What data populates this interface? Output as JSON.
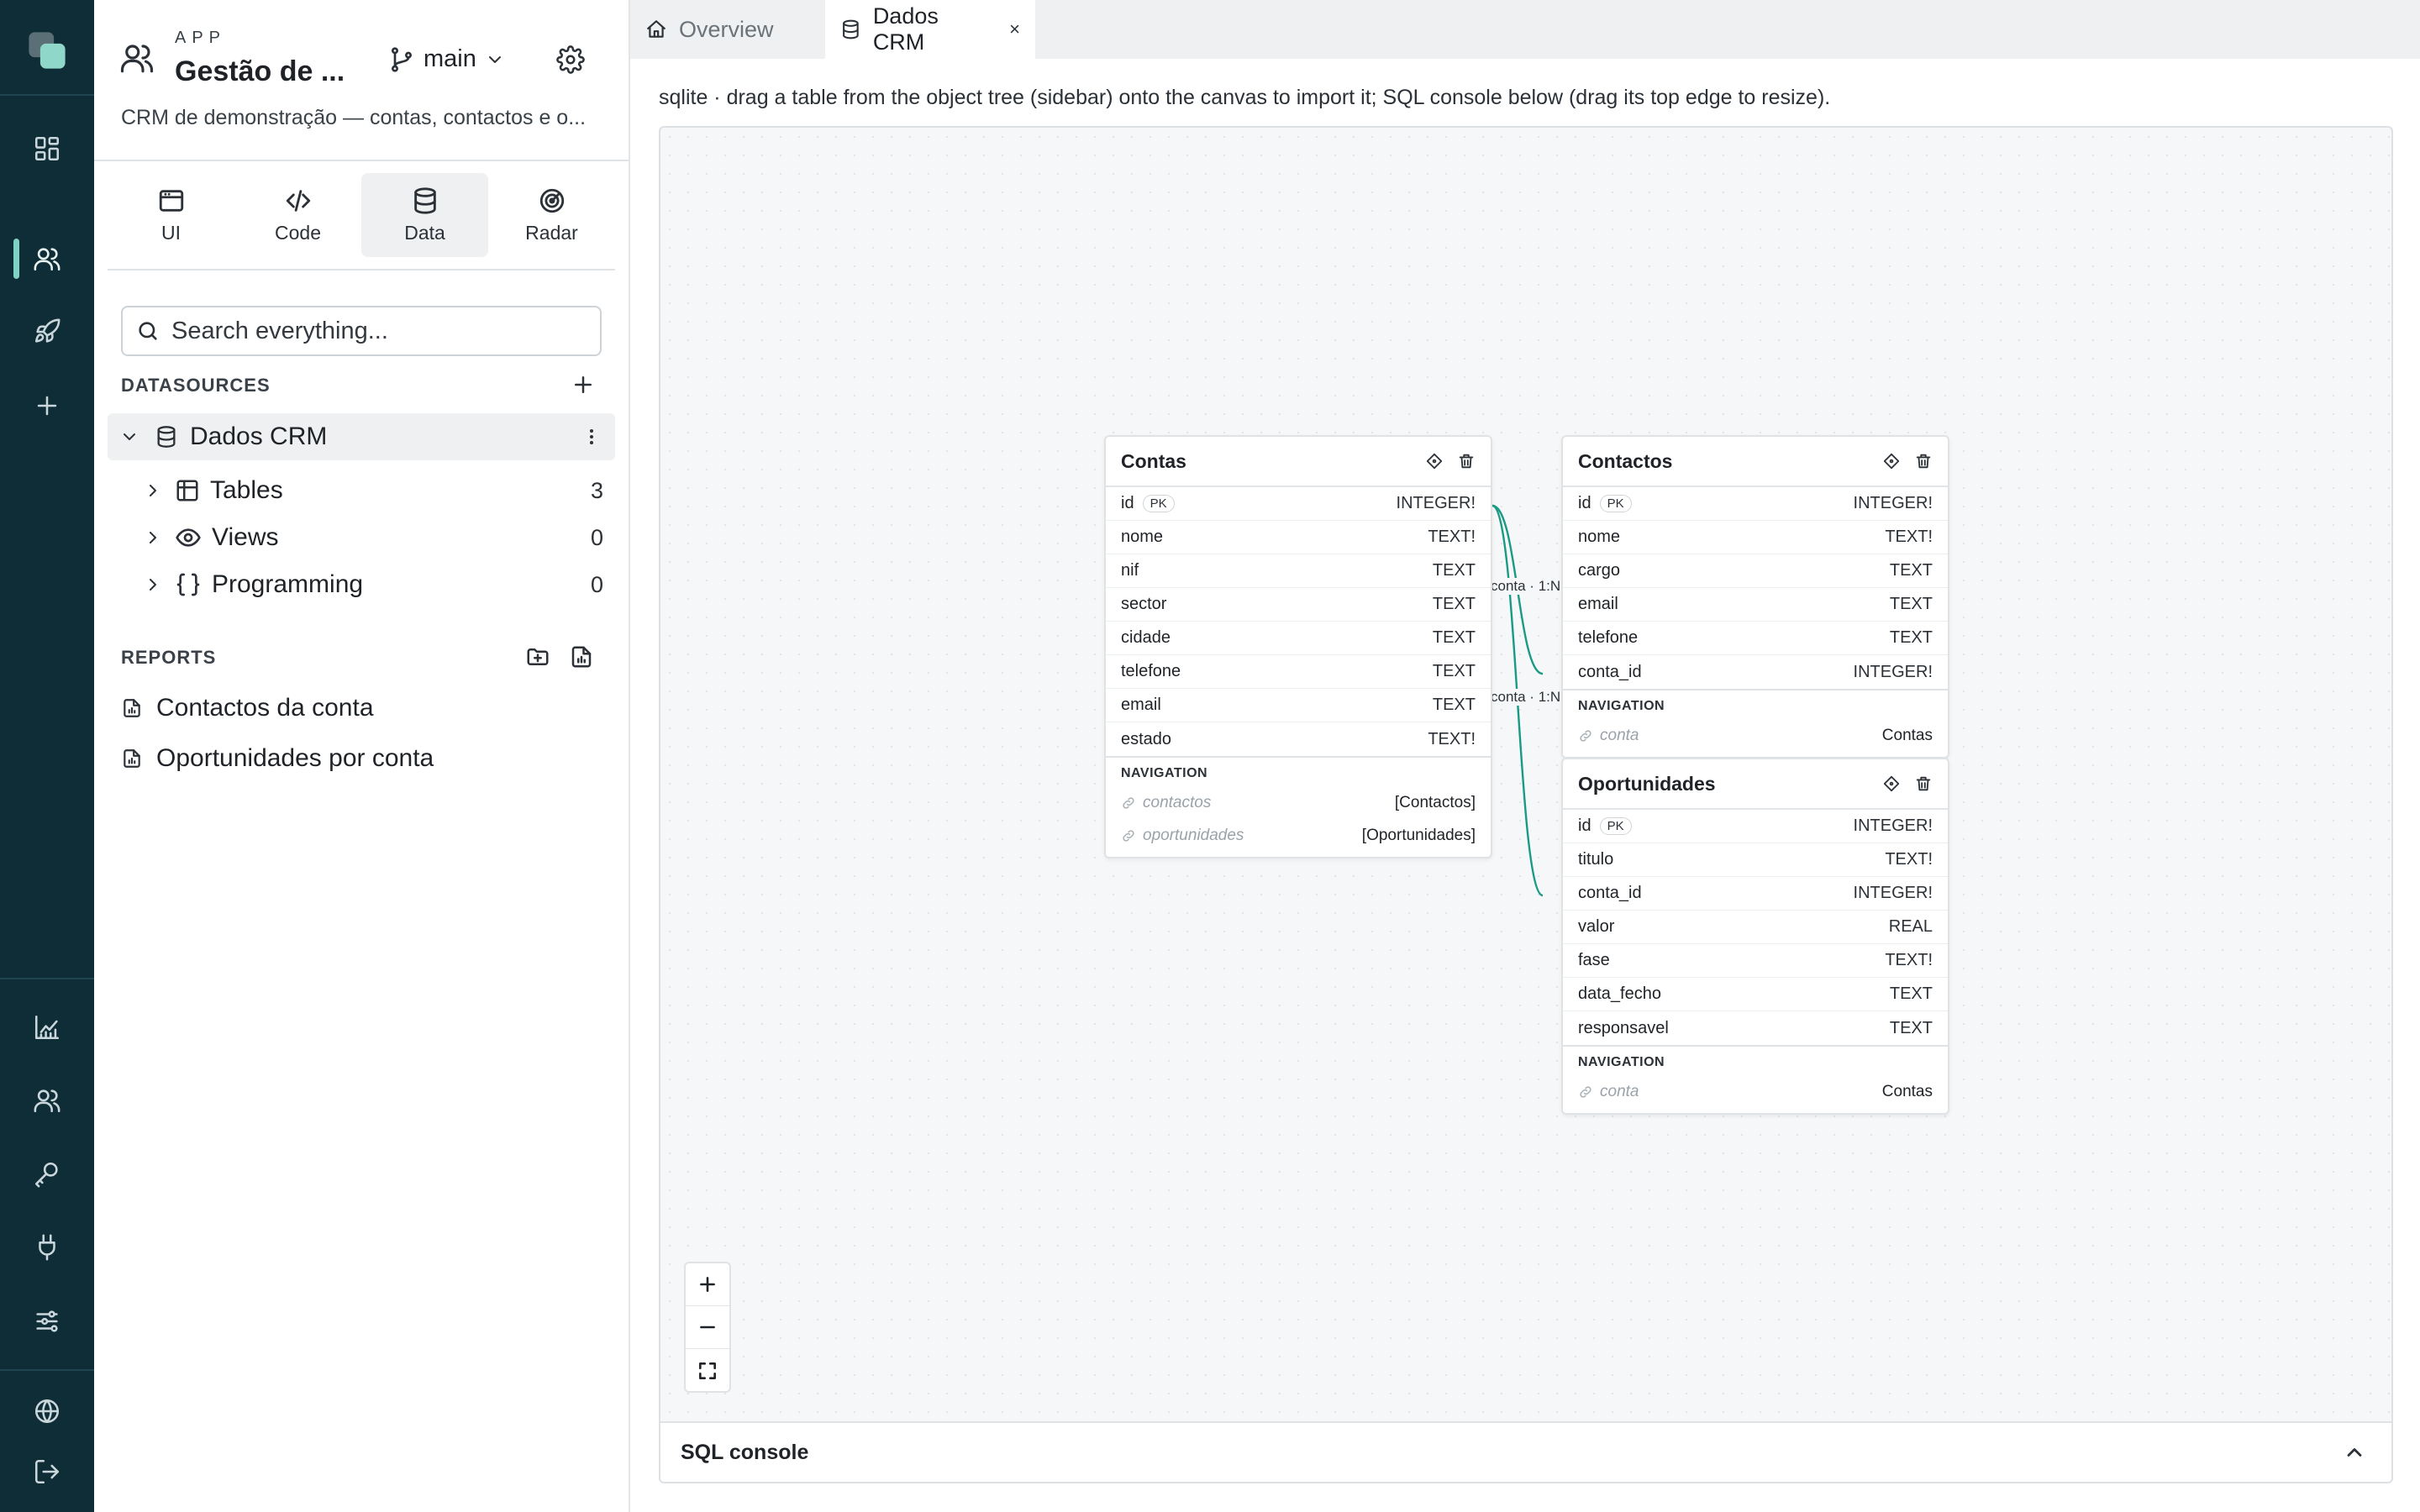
{
  "rail": {
    "icons": [
      "logo-icon",
      "dashboard-icon",
      "users-icon",
      "rocket-icon",
      "plus-icon",
      "chart-icon",
      "people-icon",
      "key-icon",
      "plug-icon",
      "sliders-icon",
      "globe-icon",
      "logout-icon"
    ],
    "accent": "#7fd3c4",
    "background": "#0f2d36"
  },
  "app": {
    "label": "APP",
    "title": "Gestão de ...",
    "description": "CRM de demonstração — contas, contactos e o...",
    "branch": "main"
  },
  "modes": [
    {
      "label": "UI",
      "icon": "window-icon"
    },
    {
      "label": "Code",
      "icon": "code-icon"
    },
    {
      "label": "Data",
      "icon": "database-icon",
      "active": true
    },
    {
      "label": "Radar",
      "icon": "radar-icon"
    }
  ],
  "search": {
    "placeholder": "Search everything..."
  },
  "datasources": {
    "title": "DATASOURCES",
    "item": {
      "name": "Dados CRM"
    },
    "tree": [
      {
        "label": "Tables",
        "count": "3"
      },
      {
        "label": "Views",
        "count": "0"
      },
      {
        "label": "Programming",
        "count": "0"
      }
    ]
  },
  "reports": {
    "title": "REPORTS",
    "items": [
      "Contactos da conta",
      "Oportunidades por conta"
    ]
  },
  "tabs": [
    {
      "label": "Overview",
      "active": false
    },
    {
      "label": "Dados CRM",
      "active": true,
      "close": "×"
    }
  ],
  "hint": "sqlite · drag a table from the object tree (sidebar) onto the canvas to import it; SQL console below (drag its top edge to resize).",
  "tables": {
    "contas": {
      "name": "Contas",
      "columns": [
        {
          "name": "id",
          "pk": "PK",
          "type": "INTEGER!"
        },
        {
          "name": "nome",
          "type": "TEXT!"
        },
        {
          "name": "nif",
          "type": "TEXT"
        },
        {
          "name": "sector",
          "type": "TEXT"
        },
        {
          "name": "cidade",
          "type": "TEXT"
        },
        {
          "name": "telefone",
          "type": "TEXT"
        },
        {
          "name": "email",
          "type": "TEXT"
        },
        {
          "name": "estado",
          "type": "TEXT!"
        }
      ],
      "navigation_title": "NAVIGATION",
      "navigation": [
        {
          "name": "contactos",
          "target": "[Contactos]"
        },
        {
          "name": "oportunidades",
          "target": "[Oportunidades]"
        }
      ]
    },
    "contactos": {
      "name": "Contactos",
      "columns": [
        {
          "name": "id",
          "pk": "PK",
          "type": "INTEGER!"
        },
        {
          "name": "nome",
          "type": "TEXT!"
        },
        {
          "name": "cargo",
          "type": "TEXT"
        },
        {
          "name": "email",
          "type": "TEXT"
        },
        {
          "name": "telefone",
          "type": "TEXT"
        },
        {
          "name": "conta_id",
          "type": "INTEGER!"
        }
      ],
      "navigation_title": "NAVIGATION",
      "navigation": [
        {
          "name": "conta",
          "target": "Contas"
        }
      ]
    },
    "oportunidades": {
      "name": "Oportunidades",
      "columns": [
        {
          "name": "id",
          "pk": "PK",
          "type": "INTEGER!"
        },
        {
          "name": "titulo",
          "type": "TEXT!"
        },
        {
          "name": "conta_id",
          "type": "INTEGER!"
        },
        {
          "name": "valor",
          "type": "REAL"
        },
        {
          "name": "fase",
          "type": "TEXT!"
        },
        {
          "name": "data_fecho",
          "type": "TEXT"
        },
        {
          "name": "responsavel",
          "type": "TEXT"
        }
      ],
      "navigation_title": "NAVIGATION",
      "navigation": [
        {
          "name": "conta",
          "target": "Contas"
        }
      ]
    }
  },
  "relations": [
    {
      "label": "conta · 1:N",
      "from": "Contas.id",
      "to": "Contactos.conta_id"
    },
    {
      "label": "conta · 1:N",
      "from": "Contas.id",
      "to": "Oportunidades.conta_id"
    }
  ],
  "relation_color": "#1a9a84",
  "sql_console": {
    "title": "SQL console"
  }
}
